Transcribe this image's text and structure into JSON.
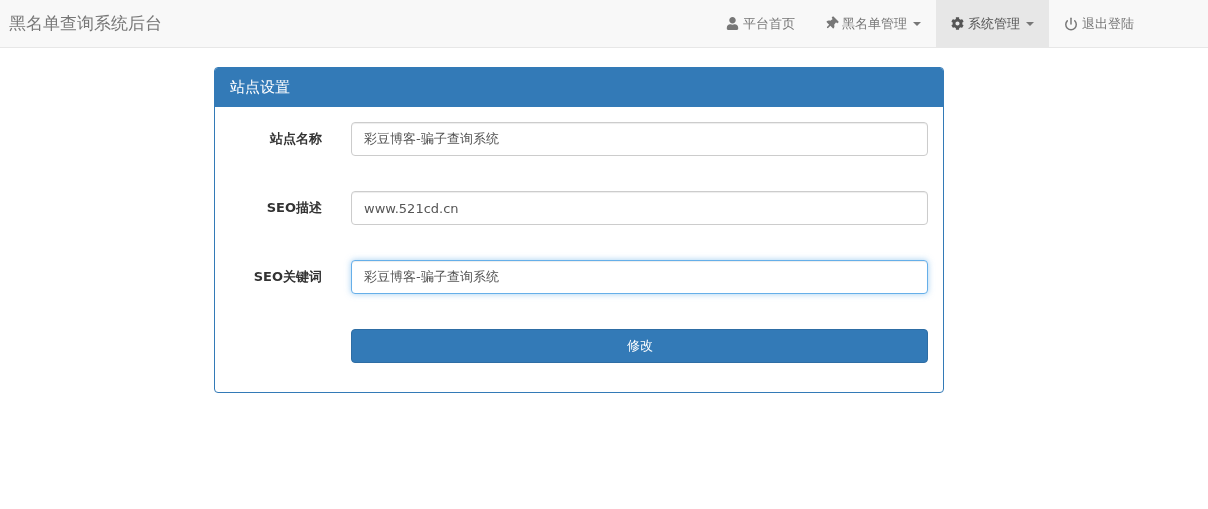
{
  "navbar": {
    "brand": "黑名单查询系统后台",
    "items": [
      {
        "label": "平台首页",
        "kind": "user",
        "dropdown": false,
        "selected": false
      },
      {
        "label": "黑名单管理",
        "kind": "pin",
        "dropdown": true,
        "selected": false
      },
      {
        "label": "系统管理",
        "kind": "gear",
        "dropdown": true,
        "selected": true
      },
      {
        "label": "退出登陆",
        "kind": "power",
        "dropdown": false,
        "selected": false
      }
    ]
  },
  "panel": {
    "title": "站点设置",
    "fields": [
      {
        "label": "站点名称",
        "value": "彩豆博客-骗子查询系统",
        "focused": false
      },
      {
        "label": "SEO描述",
        "value": "www.521cd.cn",
        "focused": false
      },
      {
        "label": "SEO关键词",
        "value": "彩豆博客-骗子查询系统",
        "focused": true
      }
    ],
    "submit": "修改"
  }
}
